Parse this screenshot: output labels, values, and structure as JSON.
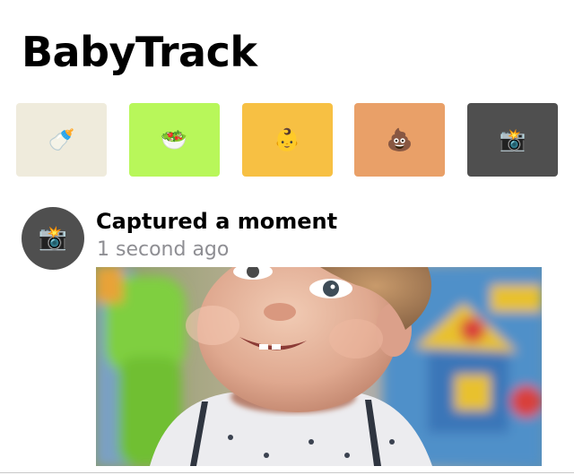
{
  "app": {
    "title": "BabyTrack"
  },
  "quick_actions": [
    {
      "emoji": "🍼",
      "icon": "baby-bottle-icon",
      "color": "#EFEBDC"
    },
    {
      "emoji": "🥗",
      "icon": "green-salad-icon",
      "color": "#B8F75A"
    },
    {
      "emoji": "👶",
      "icon": "baby-face-icon",
      "color": "#F7C043"
    },
    {
      "emoji": "💩",
      "icon": "poop-icon",
      "color": "#E9A068"
    },
    {
      "emoji": "📸",
      "icon": "camera-flash-icon",
      "color": "#4F4F4F"
    }
  ],
  "feed": {
    "item": {
      "avatar_emoji": "📸",
      "avatar_icon": "camera-flash-icon",
      "title": "Captured a moment",
      "time": "1 second ago",
      "photo": "baby-photo"
    }
  }
}
